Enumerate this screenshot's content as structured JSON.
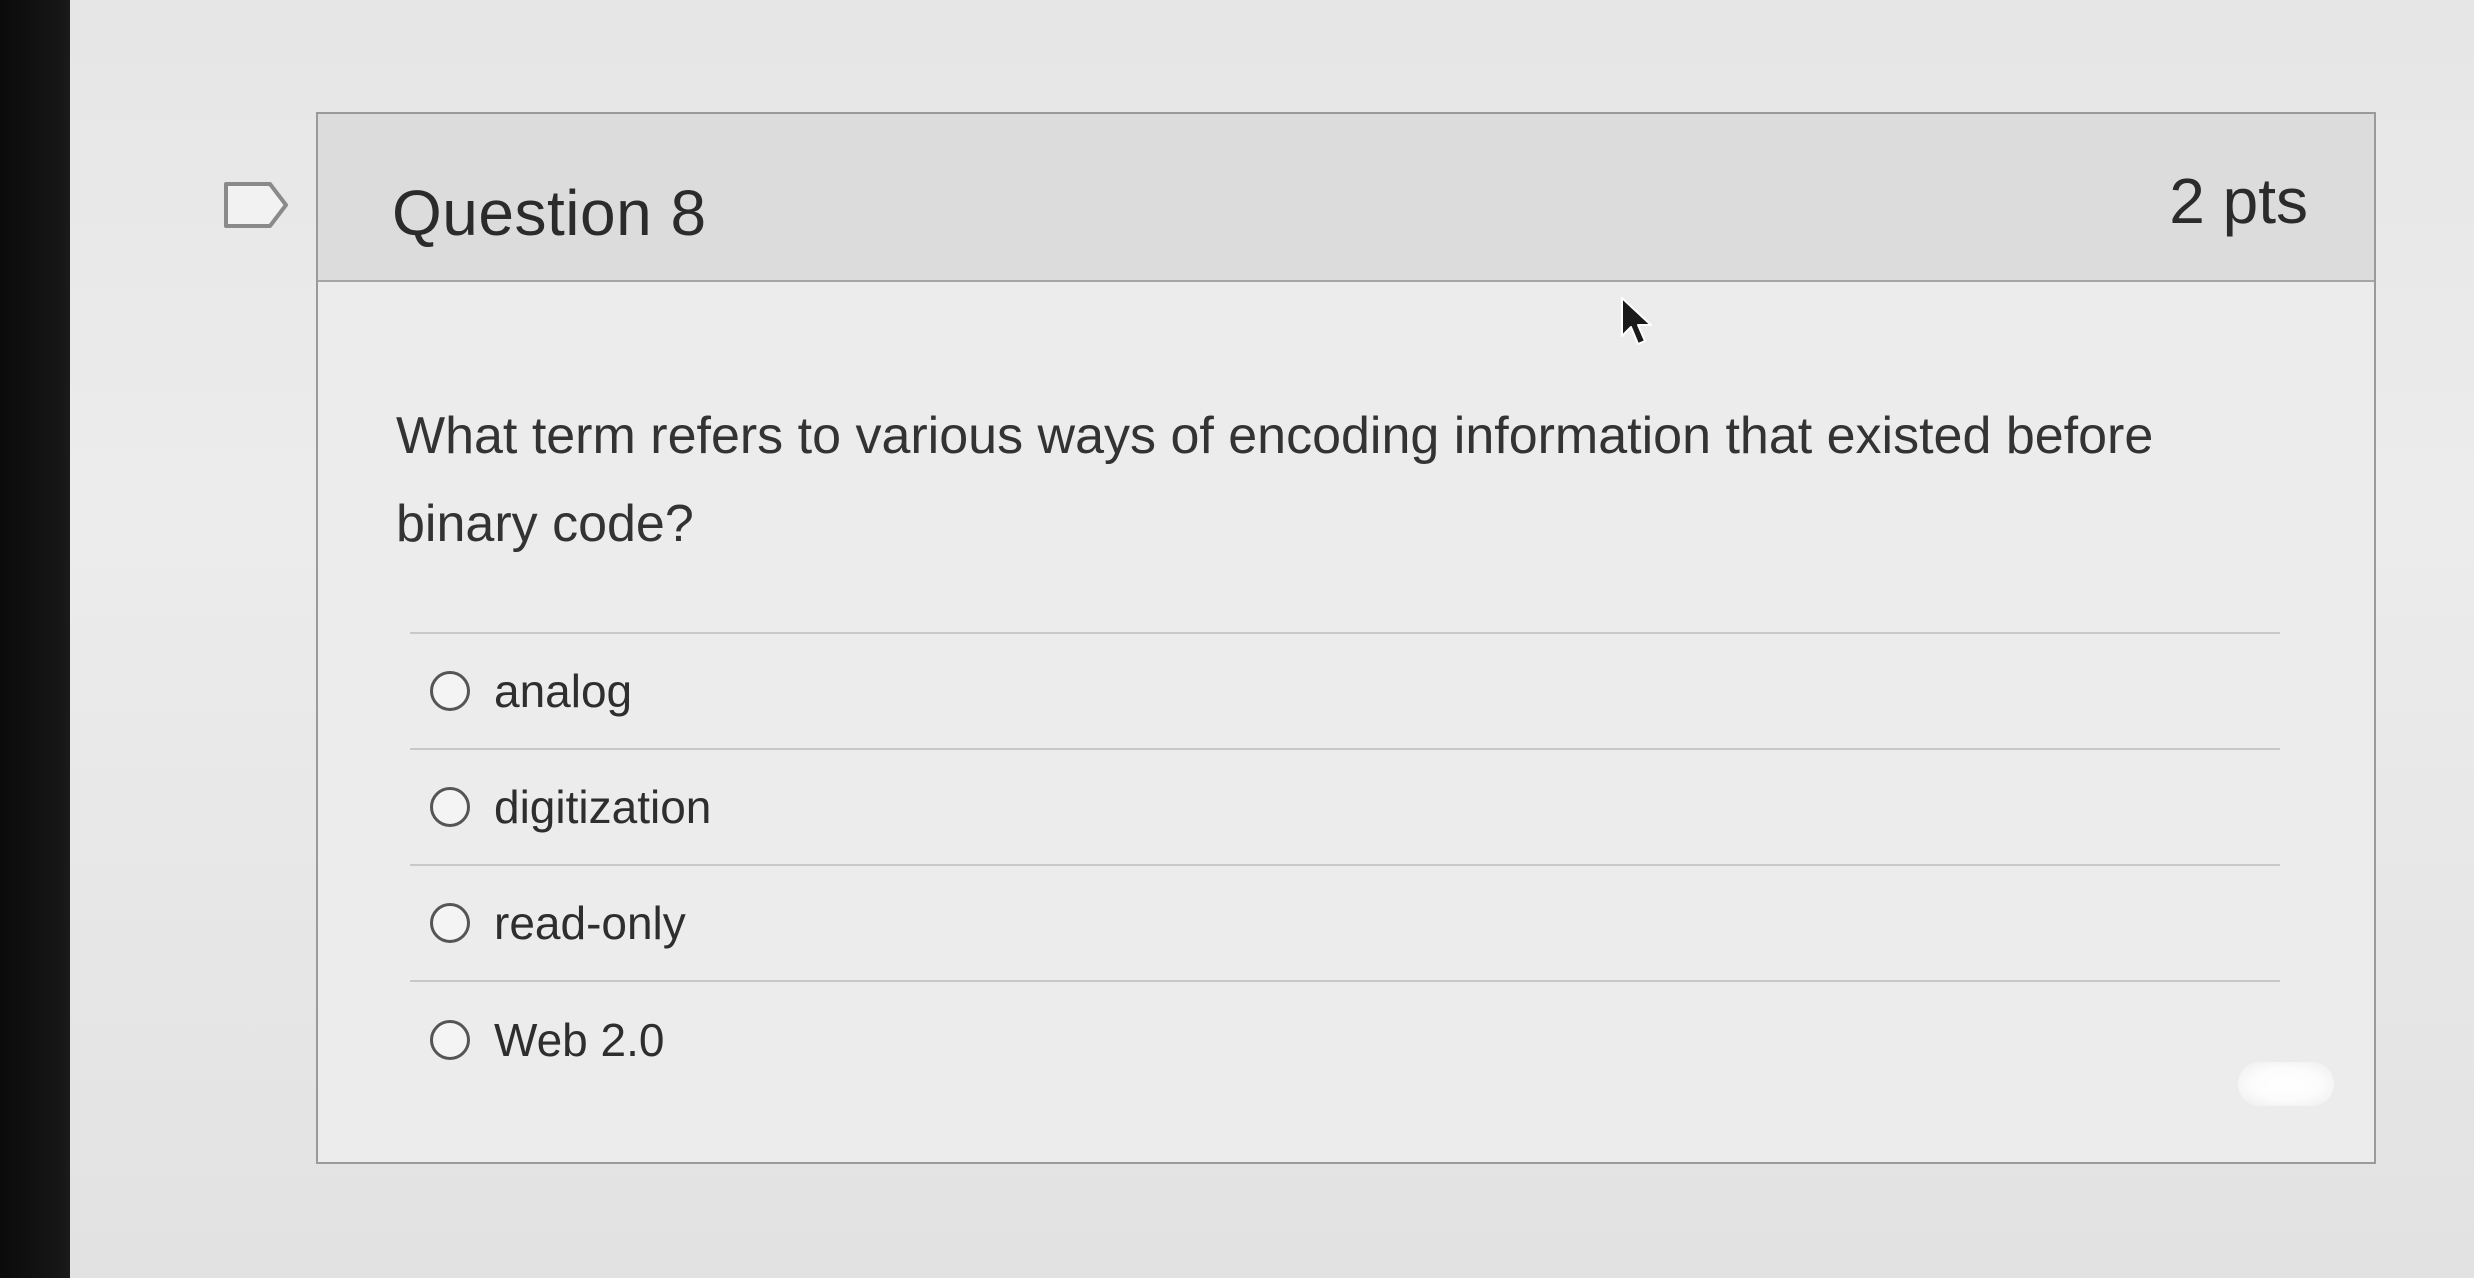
{
  "question": {
    "title": "Question 8",
    "points": "2 pts",
    "text": "What term refers to various ways of encoding information that existed before binary code?",
    "answers": [
      {
        "label": "analog",
        "selected": false
      },
      {
        "label": "digitization",
        "selected": false
      },
      {
        "label": "read-only",
        "selected": false
      },
      {
        "label": "Web 2.0",
        "selected": false
      }
    ]
  },
  "icons": {
    "bookmark": "bookmark-flag-icon",
    "cursor": "mouse-pointer-icon",
    "radio": "radio-button-icon"
  },
  "colors": {
    "header_bg": "#dcdcdc",
    "card_bg": "#ececec",
    "border": "#9a9a9a",
    "text": "#2b2b2b"
  }
}
